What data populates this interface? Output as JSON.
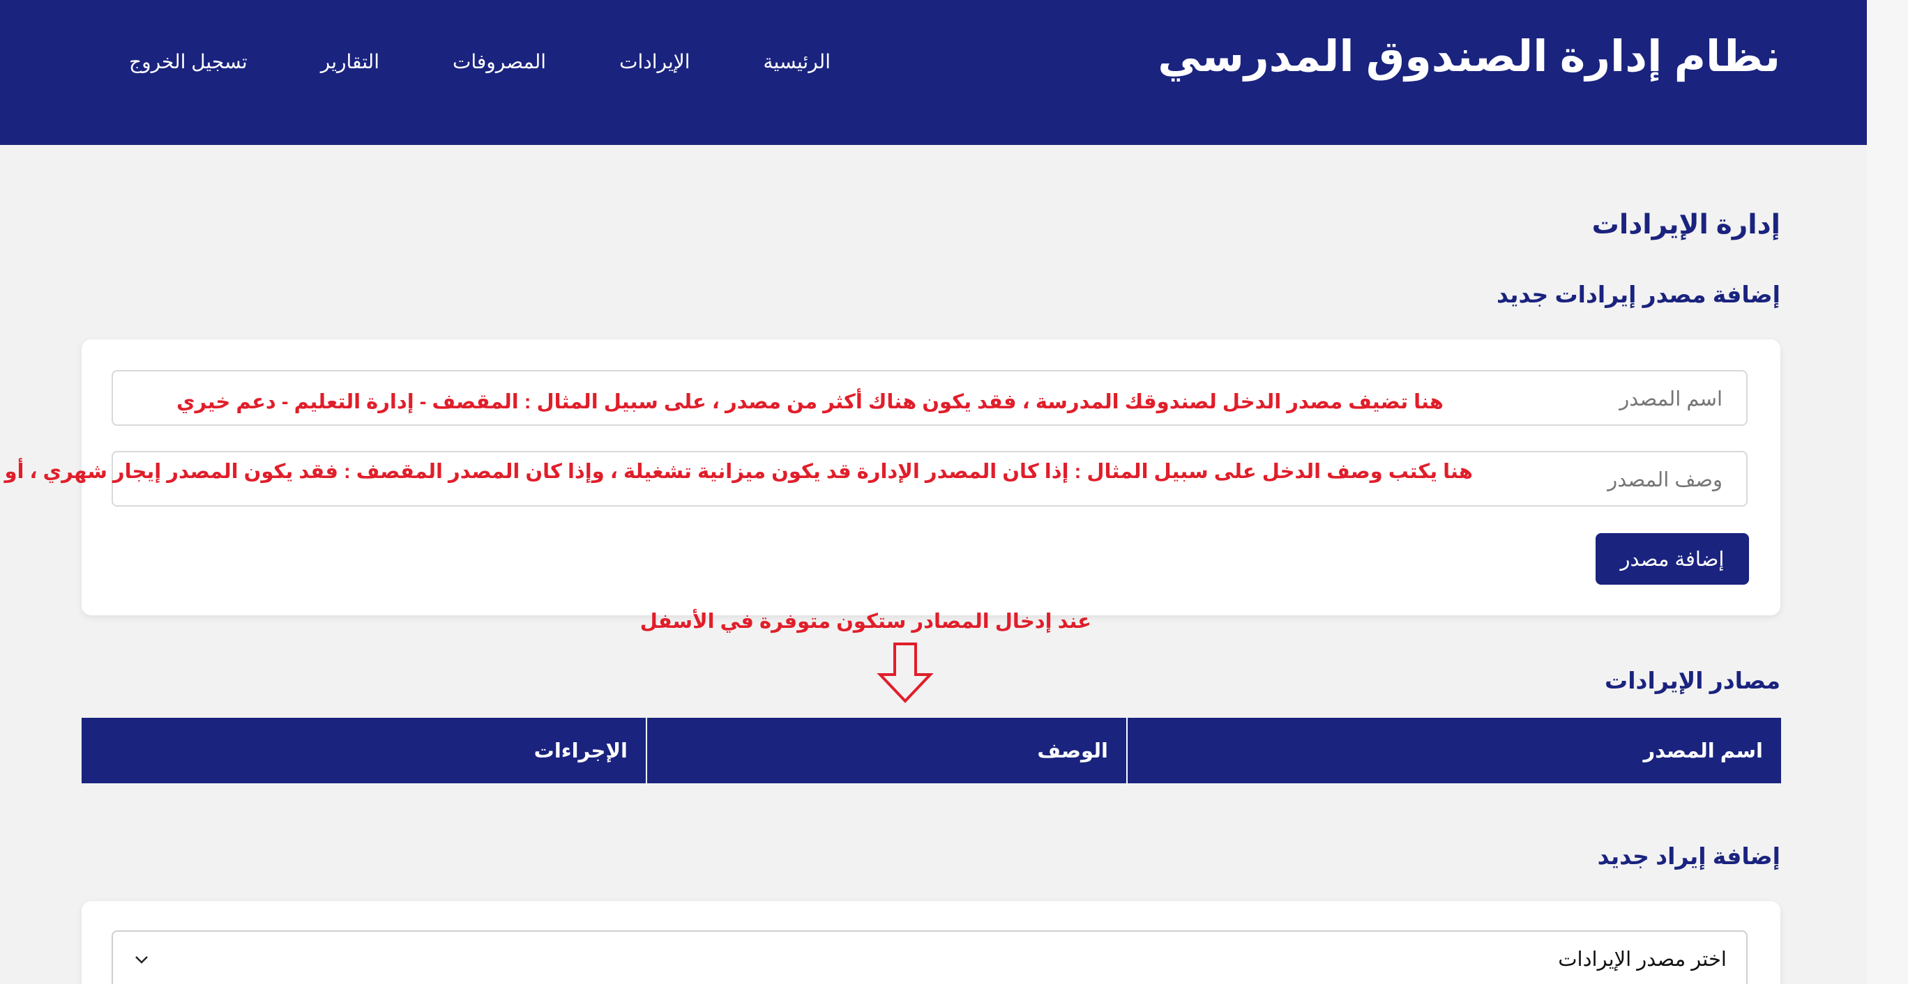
{
  "header": {
    "title": "نظام إدارة الصندوق المدرسي",
    "nav": [
      "الرئيسية",
      "الإيرادات",
      "المصروفات",
      "التقارير",
      "تسجيل الخروج"
    ]
  },
  "main": {
    "page_title": "إدارة الإيرادات",
    "add_source_title": "إضافة مصدر إيرادات جديد",
    "source_name_placeholder": "اسم المصدر",
    "source_desc_placeholder": "وصف المصدر",
    "hint_name": "هنا تضيف مصدر الدخل لصندوقك المدرسة ، فقد يكون هناك أكثر من مصدر ، على سبيل المثال : المقصف - إدارة التعليم - دعم خيري",
    "hint_desc": "هنا يكتب وصف الدخل على سبيل المثال : إذا كان المصدر الإدارة قد يكون ميزانية تشغيلة ، وإذا كان المصدر المقصف  : فقد يكون المصدر إيجار شهري ، أو دخل يومي",
    "add_source_button": "إضافة مصدر",
    "hint_below": "عند إدخال المصادر ستكون متوفرة في الأسفل",
    "sources_title": "مصادر الإيرادات",
    "table_headers": [
      "اسم المصدر",
      "الوصف",
      "الإجراءات"
    ],
    "add_revenue_title": "إضافة إيراد جديد",
    "select_placeholder": "اختر مصدر الإيرادات"
  },
  "colors": {
    "primary": "#1a237e",
    "annotation": "#e01e2a",
    "background": "#f2f2f2"
  },
  "icons": [
    "down-arrow-annotation-icon",
    "chevron-down-icon"
  ]
}
